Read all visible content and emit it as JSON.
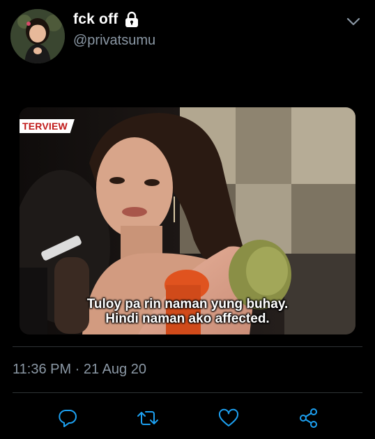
{
  "tweet": {
    "display_name": "fck off",
    "handle": "@privatsumu",
    "timestamp": "11:36 PM · 21 Aug 20"
  },
  "media": {
    "tag": "TERVIEW",
    "caption_line1": "Tuloy pa rin naman yung buhay.",
    "caption_line2": "Hindi naman ako affected."
  },
  "icons": {
    "lock": "lock-icon",
    "more": "chevron-down-icon",
    "reply": "reply-icon",
    "retweet": "retweet-icon",
    "like": "heart-icon",
    "share": "share-icon"
  },
  "colors": {
    "background": "#000000",
    "secondary_text": "#8b98a5",
    "accent": "#1da1f2",
    "divider": "#2f3336"
  }
}
